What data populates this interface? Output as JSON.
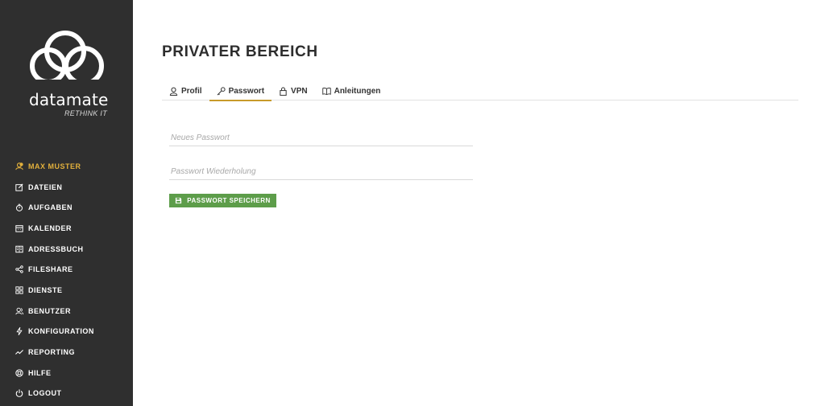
{
  "brand": {
    "name": "datamate",
    "tagline": "RETHINK IT"
  },
  "sidebar": {
    "items": [
      {
        "label": "MAX MUSTER",
        "icon": "user-badge-icon",
        "active": true
      },
      {
        "label": "DATEIEN",
        "icon": "edit-icon"
      },
      {
        "label": "AUFGABEN",
        "icon": "timer-icon"
      },
      {
        "label": "KALENDER",
        "icon": "calendar-icon"
      },
      {
        "label": "ADRESSBUCH",
        "icon": "address-book-icon"
      },
      {
        "label": "FILESHARE",
        "icon": "share-icon"
      },
      {
        "label": "DIENSTE",
        "icon": "grid-icon"
      },
      {
        "label": "BENUTZER",
        "icon": "users-icon"
      },
      {
        "label": "KONFIGURATION",
        "icon": "lightning-icon"
      },
      {
        "label": "REPORTING",
        "icon": "trend-icon"
      },
      {
        "label": "HILFE",
        "icon": "lifebuoy-icon"
      },
      {
        "label": "LOGOUT",
        "icon": "power-icon"
      }
    ]
  },
  "main": {
    "title": "PRIVATER BEREICH",
    "tabs": [
      {
        "label": "Profil",
        "icon": "user-icon"
      },
      {
        "label": "Passwort",
        "icon": "key-icon",
        "active": true
      },
      {
        "label": "VPN",
        "icon": "lock-icon"
      },
      {
        "label": "Anleitungen",
        "icon": "book-icon"
      }
    ],
    "form": {
      "new_password_placeholder": "Neues Passwort",
      "repeat_password_placeholder": "Passwort Wiederholung",
      "save_label": "PASSWORT SPEICHERN"
    }
  },
  "colors": {
    "sidebar_bg": "#2f2f2f",
    "accent": "#e2b03c",
    "button_bg": "#5d9d4a"
  }
}
